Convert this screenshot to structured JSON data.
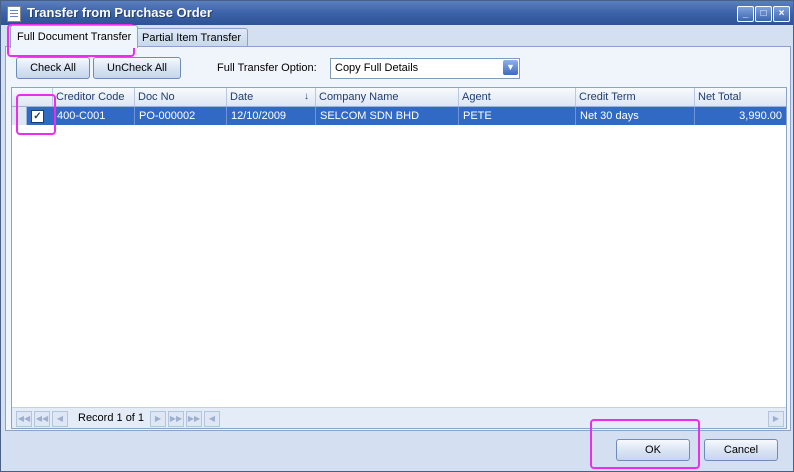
{
  "window": {
    "title": "Transfer from Purchase Order"
  },
  "tabs": [
    {
      "label": "Full Document Transfer",
      "active": true
    },
    {
      "label": "Partial Item Transfer",
      "active": false
    }
  ],
  "toolbar": {
    "check_all": "Check All",
    "uncheck_all": "UnCheck All",
    "option_label": "Full Transfer Option:",
    "option_value": "Copy Full Details"
  },
  "grid": {
    "columns": [
      "Creditor Code",
      "Doc No",
      "Date",
      "Company Name",
      "Agent",
      "Credit Term",
      "Net Total"
    ],
    "rows": [
      {
        "checked": true,
        "creditor_code": "400-C001",
        "doc_no": "PO-000002",
        "date": "12/10/2009",
        "company_name": "SELCOM SDN BHD",
        "agent": "PETE",
        "credit_term": "Net 30 days",
        "net_total": "3,990.00"
      }
    ],
    "record_text": "Record 1 of 1"
  },
  "footer": {
    "ok": "OK",
    "cancel": "Cancel"
  },
  "colors": {
    "selection": "#316ac5",
    "highlight": "#ee2cf0",
    "title_bar": "#3c62a8"
  }
}
